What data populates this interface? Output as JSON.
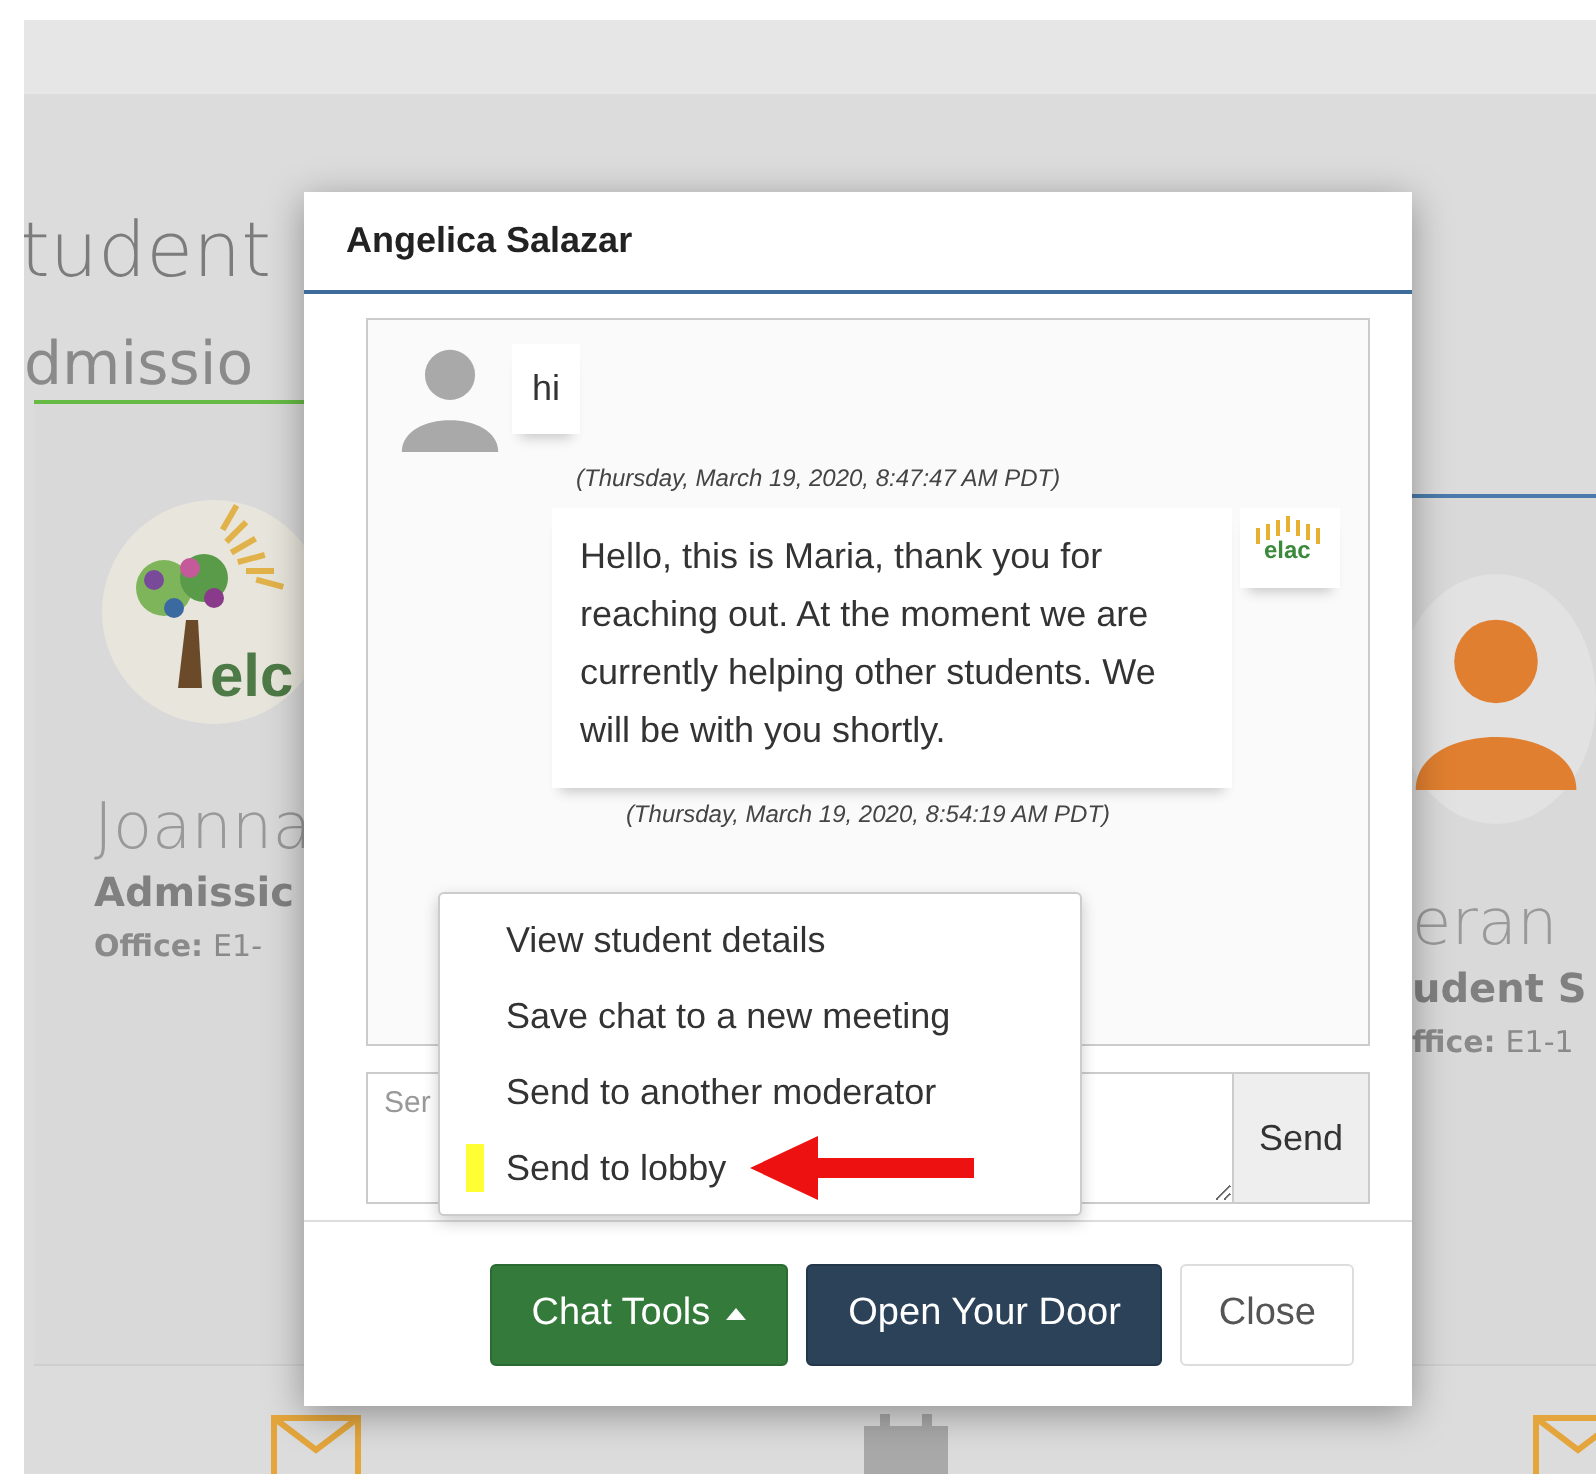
{
  "background": {
    "heading": "tudent",
    "subheading": "dmissio",
    "cards": [
      {
        "kind": "logo",
        "logo_text": "elc",
        "name": "Joanna",
        "role": "Admissic",
        "office_label": "Office:",
        "office": "E1-"
      },
      {
        "kind": "avatar",
        "name": "eran",
        "role": "udent S",
        "office_label": "ffice:",
        "office": "E1-1"
      }
    ]
  },
  "modal": {
    "title": "Angelica Salazar",
    "messages": [
      {
        "kind": "student",
        "text": "hi",
        "time": "(Thursday, March 19, 2020, 8:47:47 AM PDT)"
      },
      {
        "kind": "staff",
        "text": "Hello, this is Maria, thank you for reaching out. At the moment we are currently helping other students. We will be with you shortly.",
        "logo_text": "elac",
        "time": "(Thursday, March 19, 2020, 8:54:19 AM PDT)"
      }
    ],
    "input": {
      "placeholder": "Ser"
    },
    "send_label": "Send",
    "menu": [
      {
        "label": "View student details",
        "marked": false,
        "arrow": false
      },
      {
        "label": "Save chat to a new meeting",
        "marked": false,
        "arrow": false
      },
      {
        "label": "Send to another moderator",
        "marked": false,
        "arrow": false
      },
      {
        "label": "Send to lobby",
        "marked": true,
        "arrow": true
      }
    ],
    "buttons": [
      {
        "kind": "dropdown",
        "label": "Chat Tools",
        "expanded": true
      },
      {
        "kind": "primary",
        "label": "Open Your Door"
      },
      {
        "kind": "default",
        "label": "Close"
      }
    ]
  }
}
